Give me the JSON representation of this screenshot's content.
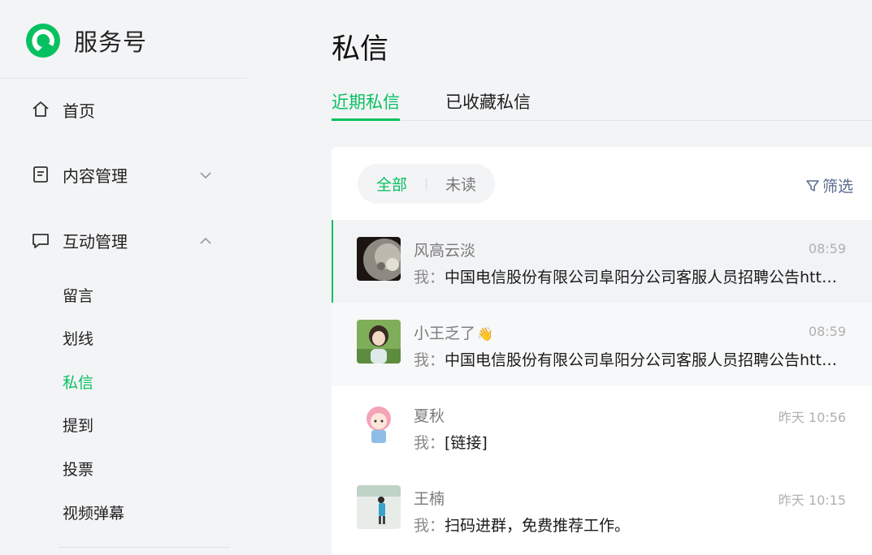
{
  "brand": {
    "name": "服务号",
    "accent": "#07c160"
  },
  "sidebar": {
    "items": [
      {
        "label": "首页",
        "icon": "home-icon"
      },
      {
        "label": "内容管理",
        "icon": "document-icon",
        "chevron": "chevron-down-icon"
      },
      {
        "label": "互动管理",
        "icon": "chat-bubble-icon",
        "chevron": "chevron-up-icon"
      }
    ],
    "sub_items": [
      {
        "label": "留言"
      },
      {
        "label": "划线"
      },
      {
        "label": "私信",
        "active": true
      },
      {
        "label": "提到"
      },
      {
        "label": "投票"
      },
      {
        "label": "视频弹幕"
      }
    ]
  },
  "main": {
    "title": "私信",
    "tabs": [
      {
        "label": "近期私信",
        "active": true
      },
      {
        "label": "已收藏私信"
      }
    ],
    "filters": {
      "all": "全部",
      "unread": "未读",
      "filter_label": "筛选"
    },
    "messages": [
      {
        "name": "风高云淡",
        "time": "08:59",
        "me": "我：",
        "text": "中国电信股份有限公司阜阳分公司客服人员招聘公告http..."
      },
      {
        "name": "小王乏了",
        "emoji": "👋",
        "time": "08:59",
        "me": "我：",
        "text": "中国电信股份有限公司阜阳分公司客服人员招聘公告http..."
      },
      {
        "name": "夏秋",
        "time": "昨天 10:56",
        "me": "我：",
        "text": "[链接]"
      },
      {
        "name": "王楠",
        "time": "昨天 10:15",
        "me": "我：",
        "text": "扫码进群，免费推荐工作。"
      }
    ]
  }
}
